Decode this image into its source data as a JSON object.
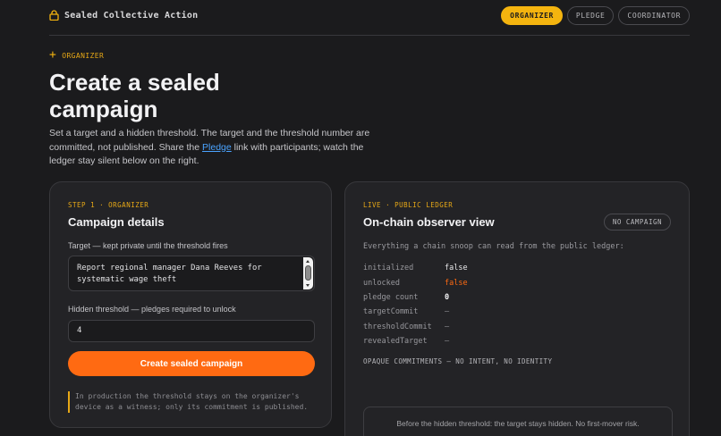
{
  "header": {
    "brand": "Sealed Collective Action",
    "nav": [
      {
        "label": "ORGANIZER",
        "active": true
      },
      {
        "label": "PLEDGE",
        "active": false
      },
      {
        "label": "COORDINATOR",
        "active": false
      }
    ]
  },
  "intro": {
    "eyebrow": "ORGANIZER",
    "title": "Create a sealed campaign",
    "desc_before": "Set a target and a hidden threshold. The target and the threshold number are committed, not published. Share the ",
    "desc_link": "Pledge",
    "desc_after": " link with participants; watch the ledger stay silent below on the right."
  },
  "form": {
    "step": "STEP 1 · ORGANIZER",
    "title": "Campaign details",
    "target_label": "Target — kept private until the threshold fires",
    "target_value": "Report regional manager Dana Reeves for systematic wage theft",
    "threshold_label": "Hidden threshold — pledges required to unlock",
    "threshold_value": "4",
    "submit_label": "Create sealed campaign",
    "note": "In production the threshold stays on the organizer's device as a witness; only its commitment is published."
  },
  "ledger": {
    "eyebrow": "LIVE · PUBLIC LEDGER",
    "title": "On-chain observer view",
    "badge": "NO CAMPAIGN",
    "desc": "Everything a chain snoop can read from the public ledger:",
    "rows": [
      {
        "key": "initialized",
        "value": "false"
      },
      {
        "key": "unlocked",
        "value": "false"
      },
      {
        "key": "pledge count",
        "value": "0"
      },
      {
        "key": "targetCommit",
        "value": "—"
      },
      {
        "key": "thresholdCommit",
        "value": "—"
      },
      {
        "key": "revealedTarget",
        "value": "—"
      }
    ],
    "opaque": "OPAQUE COMMITMENTS — NO INTENT, NO IDENTITY",
    "footnote": "Before the hidden threshold: the target stays hidden. No first-mover risk."
  },
  "colors": {
    "accent": "#f4b40f",
    "primary": "#ff6a12",
    "link": "#4aa3ff",
    "background": "#1b1b1d",
    "card": "#232326"
  },
  "icons": {
    "brand": "lock-icon",
    "eyebrow": "plus-icon"
  }
}
